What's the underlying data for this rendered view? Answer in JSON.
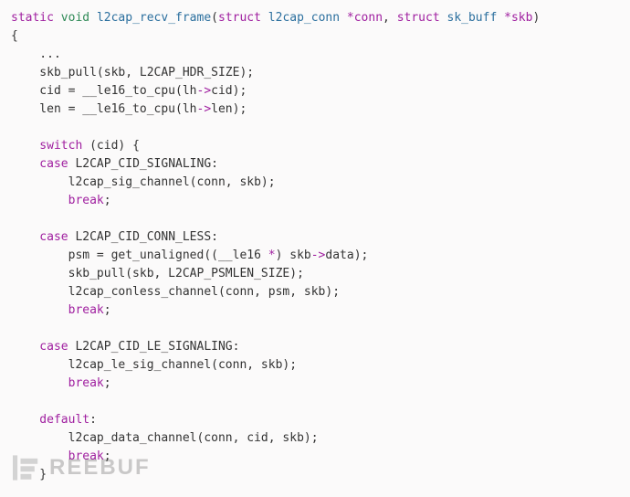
{
  "watermark": {
    "text": "REEBUF"
  },
  "code": {
    "static": "static",
    "void": "void",
    "fn_name": "l2cap_recv_frame",
    "struct1_kw": "struct",
    "struct1_type": "l2cap_conn",
    "param1": "*conn",
    "struct2_kw": "struct",
    "struct2_type": "sk_buff",
    "param2": "*skb",
    "obrace": "{",
    "ellipsis": "    ...",
    "l1": "    skb_pull(skb, L2CAP_HDR_SIZE);",
    "l2_a": "    cid = __le16_to_cpu(lh",
    "l2_b": "->",
    "l2_c": "cid);",
    "l3_a": "    len = __le16_to_cpu(lh",
    "l3_b": "->",
    "l3_c": "len);",
    "switch_kw": "    switch",
    "switch_rest": " (cid) {",
    "case1_kw": "    case",
    "case1_rest": " L2CAP_CID_SIGNALING:",
    "case1_body": "        l2cap_sig_channel(conn, skb);",
    "break1": "        break",
    "case2_kw": "    case",
    "case2_rest": " L2CAP_CID_CONN_LESS:",
    "case2_l1_a": "        psm = get_unaligned((__le16 ",
    "case2_l1_b": "*",
    "case2_l1_c": ") skb",
    "case2_l1_d": "->",
    "case2_l1_e": "data);",
    "case2_l2": "        skb_pull(skb, L2CAP_PSMLEN_SIZE);",
    "case2_l3": "        l2cap_conless_channel(conn, psm, skb);",
    "break2": "        break",
    "case3_kw": "    case",
    "case3_rest": " L2CAP_CID_LE_SIGNALING:",
    "case3_body": "        l2cap_le_sig_channel(conn, skb);",
    "break3": "        break",
    "default_kw": "    default",
    "default_colon": ":",
    "default_body": "        l2cap_data_channel(conn, cid, skb);",
    "break4": "        break",
    "cbrace_inner": "    }",
    "semicolon": ";"
  }
}
